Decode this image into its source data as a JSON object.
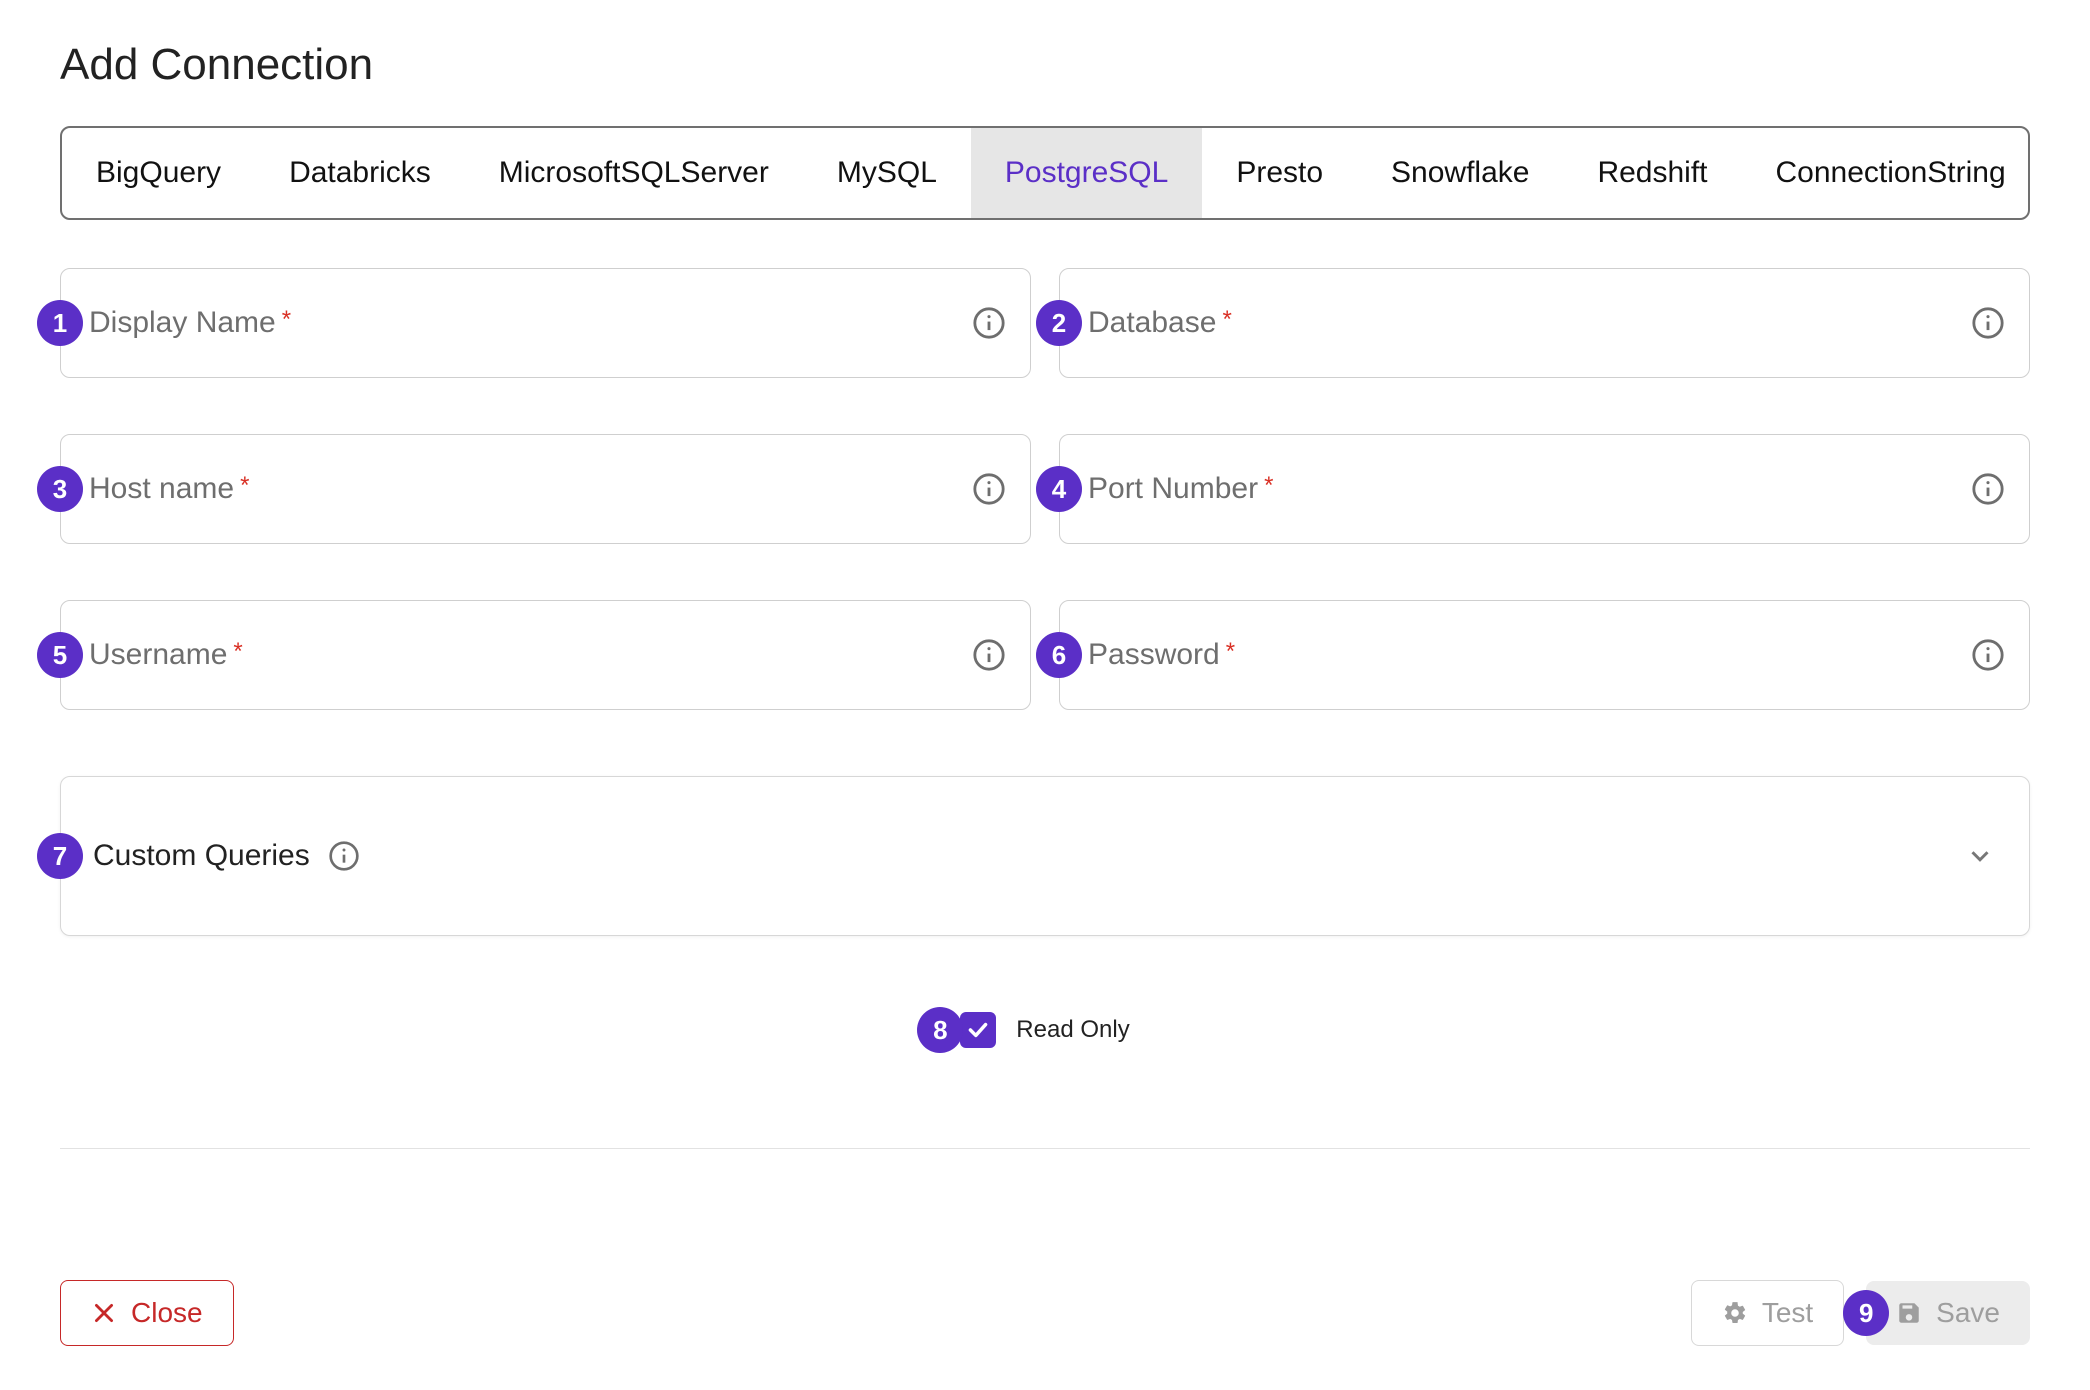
{
  "title": "Add Connection",
  "tabs": [
    {
      "label": "BigQuery"
    },
    {
      "label": "Databricks"
    },
    {
      "label": "MicrosoftSQLServer"
    },
    {
      "label": "MySQL"
    },
    {
      "label": "PostgreSQL"
    },
    {
      "label": "Presto"
    },
    {
      "label": "Snowflake"
    },
    {
      "label": "Redshift"
    },
    {
      "label": "ConnectionString"
    }
  ],
  "active_tab_index": 4,
  "fields": {
    "display_name": {
      "label": "Display Name",
      "required": true
    },
    "database": {
      "label": "Database",
      "required": true
    },
    "host_name": {
      "label": "Host name",
      "required": true
    },
    "port_number": {
      "label": "Port Number",
      "required": true
    },
    "username": {
      "label": "Username",
      "required": true
    },
    "password": {
      "label": "Password",
      "required": true
    }
  },
  "accordion": {
    "label": "Custom Queries"
  },
  "read_only": {
    "label": "Read Only",
    "checked": true
  },
  "buttons": {
    "close": "Close",
    "test": "Test",
    "save": "Save"
  },
  "callouts": [
    "1",
    "2",
    "3",
    "4",
    "5",
    "6",
    "7",
    "8",
    "9"
  ]
}
